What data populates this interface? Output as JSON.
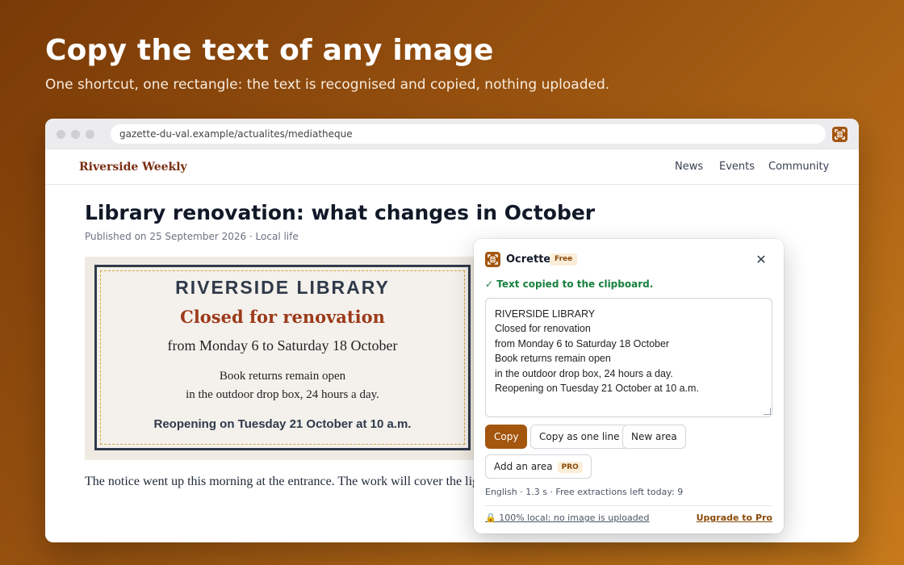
{
  "hero": {
    "title": "Copy the text of any image",
    "subtitle": "One shortcut, one rectangle: the text is recognised and copied, nothing uploaded."
  },
  "browser": {
    "url": "gazette-du-val.example/actualites/mediatheque",
    "extension_icon": "ocr-extension-icon"
  },
  "site": {
    "logo": "Riverside Weekly",
    "nav": [
      "News",
      "Events",
      "Community"
    ]
  },
  "article": {
    "title": "Library renovation: what changes in October",
    "meta": "Published on 25 September 2026 · Local life",
    "body": "The notice went up this morning at the entrance. The work will cover the lighting of the reading room."
  },
  "notice": {
    "line1": "RIVERSIDE LIBRARY",
    "line2": "Closed for renovation",
    "line3": "from Monday 6 to Saturday 18 October",
    "line4": "Book returns remain open",
    "line5": "in the outdoor drop box, 24 hours a day.",
    "line6": "Reopening on Tuesday 21 October at 10 a.m."
  },
  "popup": {
    "app_name": "Ocrette",
    "plan_badge": "Free",
    "close_icon": "close-icon",
    "status": "✓ Text copied to the clipboard.",
    "extracted_text": "RIVERSIDE LIBRARY\nClosed for renovation\nfrom Monday 6 to Saturday 18 October\nBook returns remain open\nin the outdoor drop box, 24 hours a day.\nReopening on Tuesday 21 October at 10 a.m.",
    "buttons": {
      "copy": "Copy",
      "copy_one_line": "Copy as one line",
      "new_area": "New area",
      "add_area": "Add an area",
      "pro_badge": "PRO"
    },
    "info": "English · 1.3 s · Free extractions left today: 9",
    "local_note": "100% local: no image is uploaded",
    "upgrade": "Upgrade to Pro"
  },
  "colors": {
    "accent": "#a4560f",
    "success": "#15803d",
    "site_logo": "#7a2e12"
  }
}
